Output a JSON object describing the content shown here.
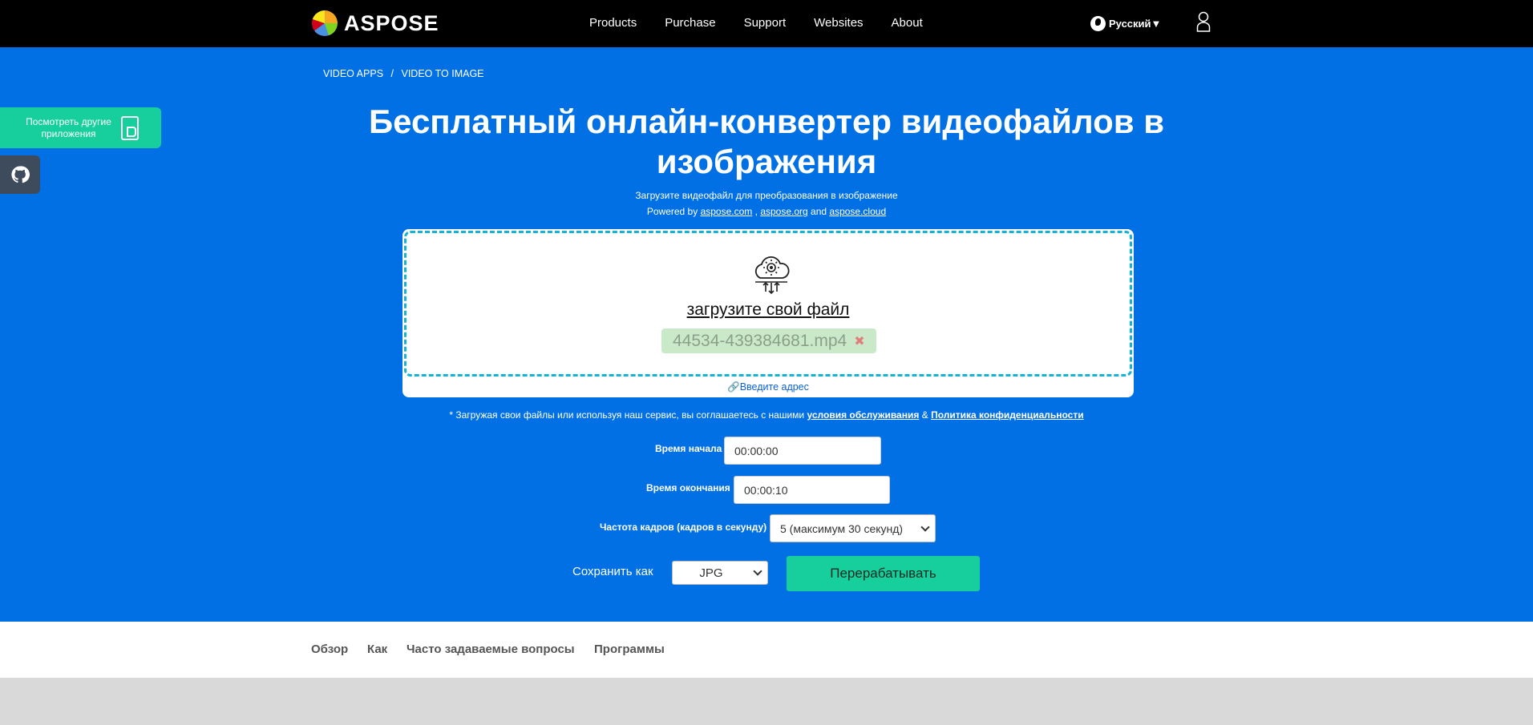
{
  "header": {
    "logo_text": "ASPOSE",
    "nav": [
      "Products",
      "Purchase",
      "Support",
      "Websites",
      "About"
    ],
    "language": "Русский"
  },
  "breadcrumb": [
    "VIDEO APPS",
    "/",
    "VIDEO TO IMAGE"
  ],
  "side": {
    "apps_label": "Посмотреть другие приложения"
  },
  "hero": {
    "title": "Бесплатный онлайн-конвертер видеофайлов в изображения",
    "subtitle": "Загрузите видеофайл для преобразования в изображение",
    "powered_prefix": "Powered by",
    "powered_links": [
      "aspose.com",
      "aspose.org",
      "aspose.cloud"
    ],
    "powered_sep1": ",",
    "powered_sep2": "and"
  },
  "upload": {
    "link_label": "загрузите свой файл",
    "file_name": "44534-439384681.mp4",
    "remove_symbol": "✖",
    "url_label": "Введите адрес"
  },
  "terms": {
    "text": "* Загружая свои файлы или используя наш сервис, вы соглашаетесь с нашими",
    "tos": "условия обслуживания",
    "amp": "&",
    "privacy": "Политика конфиденциальности"
  },
  "form": {
    "start_label": "Время начала",
    "start_value": "00:00:00",
    "end_label": "Время окончания",
    "end_value": "00:00:10",
    "fps_label": "Частота кадров (кадров в секунду)",
    "fps_value": "5 (максимум 30 секунд)",
    "save_as_label": "Сохранить как",
    "format_value": "JPG",
    "process_label": "Перерабатывать"
  },
  "lower_nav": [
    "Обзор",
    "Как",
    "Часто задаваемые вопросы",
    "Программы"
  ],
  "colors": {
    "hero_bg": "#0170e5",
    "accent": "#17cf9c",
    "dash_border": "#13b2d6",
    "header_bg": "#000000"
  }
}
